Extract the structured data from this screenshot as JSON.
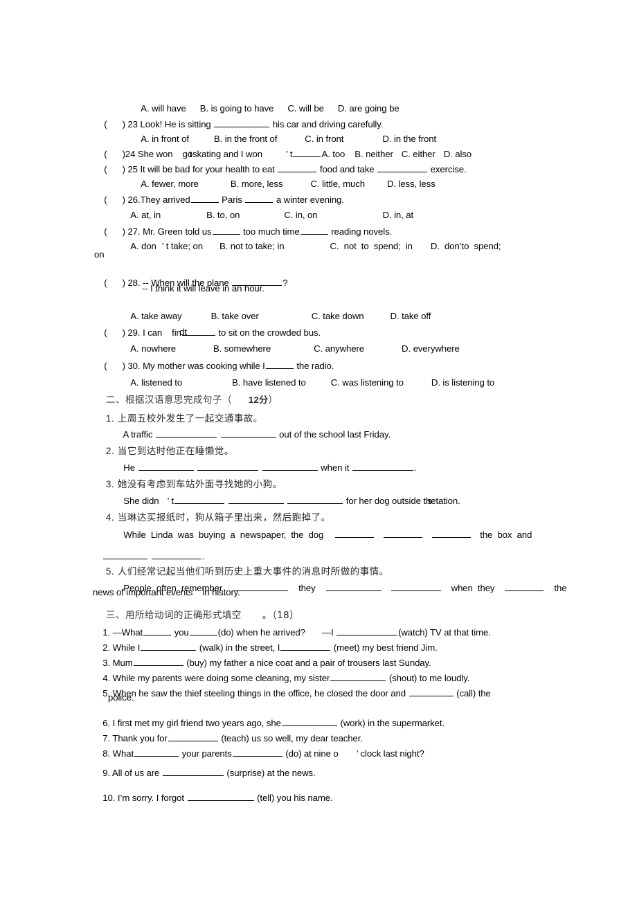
{
  "document": {
    "type": "english-grammar-worksheet",
    "page_background": "#ffffff",
    "text_color": "#000000"
  },
  "mcq": {
    "q22_options": {
      "a": "A. will have",
      "b": "B. is going to have",
      "c": "C. will be",
      "d": "D. are going be"
    },
    "q23": {
      "paren_open": "(",
      "paren_close": ")",
      "number": "23",
      "stem_pre": "Look! He is sitting",
      "stem_post": "his car and driving carefully.",
      "options": {
        "a": "A. in front of",
        "b": "B. in the front of",
        "c": "C. in front",
        "d": "D. in the front"
      }
    },
    "q24": {
      "paren_open": "(",
      "paren_close": ")",
      "number": "24",
      "stem_a": "She won",
      "stem_overlap_1": "go",
      "stem_overlap_2": "t",
      "stem_b": "skating and I won",
      "apostrophe": "’",
      "stem_c": "t",
      "options": {
        "a": "A. too",
        "b": "B. neither",
        "c": "C. either",
        "d": "D. also"
      }
    },
    "q25": {
      "paren_open": "(",
      "paren_close": ")",
      "number": "25",
      "stem_pre": "It will be bad for your health to eat",
      "stem_mid": "food and take",
      "stem_post": "exercise.",
      "options": {
        "a": "A. fewer, more",
        "b": "B. more, less",
        "c": "C. little, much",
        "d": "D. less, less"
      }
    },
    "q26": {
      "paren_open": "(",
      "paren_close": ")",
      "number": "26.",
      "stem_pre": "They arrived",
      "stem_mid": "Paris",
      "stem_post": "a winter evening.",
      "options": {
        "a": "A. at, in",
        "b": "B. to, on",
        "c": "C. in, on",
        "d": "D. in, at"
      }
    },
    "q27": {
      "paren_open": "(",
      "paren_close": ")",
      "number": "27.",
      "stem_pre": "Mr. Green told us",
      "stem_mid": "too much time",
      "stem_post": "reading novels.",
      "options": {
        "a_1": "A. don",
        "a_apos": "’",
        "a_2": "t take; on",
        "b": "B. not to take; in",
        "c": "C.  not  to  spend;  in",
        "d_1": "D.  don",
        "d_apos": "’",
        "d_2": "t",
        "d_3": "o  spend;",
        "d_wrap": "on"
      }
    },
    "q28": {
      "paren_open": "(",
      "paren_close": ")",
      "number": "28.",
      "stem_pre": "-- When will the plane",
      "stem_post": "?",
      "reply": "-- I think it will leave in an hour.",
      "options": {
        "a": "A. take away",
        "b": "B. take over",
        "c": "C. take down",
        "d": "D. take off"
      }
    },
    "q29": {
      "paren_open": "(",
      "paren_close": ")",
      "number": "29.",
      "stem_pre": "I can",
      "stem_overlap_1": "fin",
      "stem_overlap_2": "dt",
      "stem_post": "to sit on the crowded bus.",
      "options": {
        "a": "A. nowhere",
        "b": "B. somewhere",
        "c": "C. anywhere",
        "d": "D. everywhere"
      }
    },
    "q30": {
      "paren_open": "(",
      "paren_close": ")",
      "number": "30.",
      "stem_pre": "My mother was cooking while I",
      "stem_post": "the radio.",
      "options": {
        "a": "A. listened to",
        "b": "B. have listened to",
        "c": "C. was listening to",
        "d": "D. is listening to"
      }
    }
  },
  "section2": {
    "heading": "二、根据汉语意思完成句子（",
    "heading_points": "12分",
    "heading_close": "）",
    "items": [
      {
        "num": "1.",
        "chinese": "上周五校外发生了一起交通事故。",
        "english_pre": "A traffic",
        "english_post": "out of the school last Friday."
      },
      {
        "num": "2.",
        "chinese": "当它到达时他正在睡懒觉。",
        "english_pre": "He",
        "english_mid": "when it",
        "english_post": "."
      },
      {
        "num": "3.",
        "chinese": "她没有考虑到车站外面寻找她的小狗。",
        "english_pre": "She didn",
        "english_apos": "’",
        "english_t": "t",
        "english_post_1": "for her dog outside th",
        "english_post_overlap": "s",
        "english_post_2": "e",
        "english_post_3": "tation."
      },
      {
        "num": "4.",
        "chinese": "当琳达买报纸时，狗从箱子里出来，然后跑掉了。",
        "english_line1_pre": "While  Linda  was  buying  a  newspaper,  the  dog",
        "english_line1_post": "the  box  and",
        "english_line2_post": "."
      },
      {
        "num": "5.",
        "chinese": "人们经常记起当他们听到历史上重大事件的消息时所做的事情。",
        "english_line1_a": "People  often  remember",
        "english_line1_b": "they",
        "english_line1_c": "when  they",
        "english_line1_d": "the",
        "english_line2": "news of important events    in history."
      }
    ]
  },
  "section3": {
    "heading": "三、用所给动词的正确形式填空",
    "heading_points": "。（18）",
    "items": [
      {
        "num": "1.",
        "a": "—What",
        "b": "you",
        "c": "(do) when he arrived?",
        "d": "—I",
        "e": "(watch) TV at that time."
      },
      {
        "num": "2.",
        "a": "While I",
        "b": "(walk) in the street, I",
        "c": "(meet) my best friend Jim."
      },
      {
        "num": "3.",
        "a": "Mum",
        "b": "(buy) my father a nice coat and a pair of trousers last Sunday."
      },
      {
        "num": "4.",
        "a": "While my parents were doing some cleaning, my sister",
        "b": "(shout) to me loudly."
      },
      {
        "num": "5.",
        "a": "When he saw the thief steeling things in the office, he closed the door and",
        "b": "(call) the",
        "c": "police."
      },
      {
        "num": "6.",
        "a": "I first met my girl friend two years ago, she",
        "b": "(work) in the supermarket."
      },
      {
        "num": "7.",
        "a": "Thank you for",
        "b": "(teach) us so well, my dear teacher."
      },
      {
        "num": "8.",
        "a": "What",
        "b": "your parents",
        "c": "(do) at nine o",
        "apos": "’",
        "d": "clock last night?"
      },
      {
        "num": "9.",
        "a": "All of us are",
        "b": "(surprise) at the news."
      },
      {
        "num": "10.",
        "a": "I",
        "apos": "’",
        "b": "m sorry. I forgot",
        "c": "(tell) you his name."
      }
    ]
  }
}
